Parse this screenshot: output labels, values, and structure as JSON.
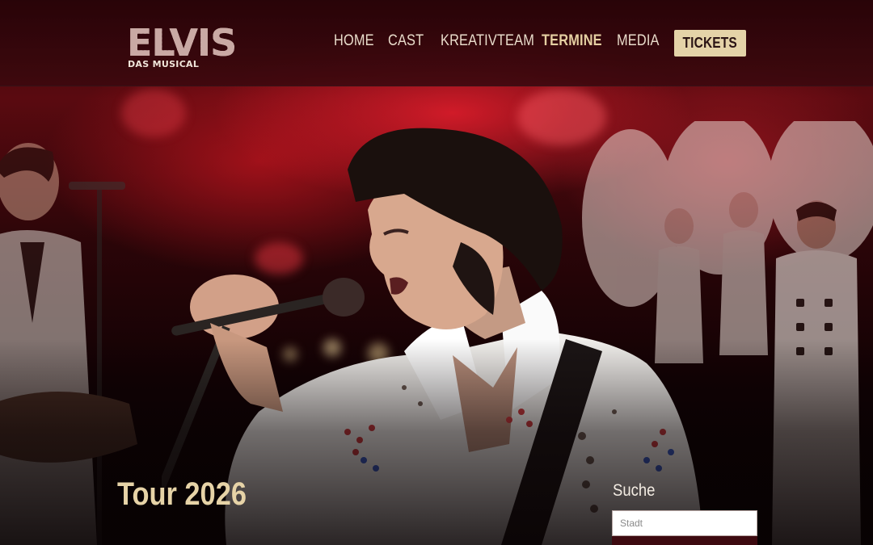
{
  "logo": {
    "word": "ELVIS",
    "subtitle": "DAS MUSICAL"
  },
  "nav": {
    "items": [
      {
        "label": "HOME",
        "active": false
      },
      {
        "label": "CAST",
        "active": false
      },
      {
        "label": "KREATIVTEAM",
        "active": false
      },
      {
        "label": "TERMINE",
        "active": true
      },
      {
        "label": "MEDIA",
        "active": false
      }
    ],
    "tickets_label": "TICKETS"
  },
  "hero": {
    "image": "elvis-singer-performance-photo"
  },
  "tour": {
    "title": "Tour 2026"
  },
  "search": {
    "label": "Suche",
    "placeholder": "Stadt",
    "value": ""
  },
  "colors": {
    "accent": "#e4d3a8",
    "header_bg": "#3a060c",
    "primary_red": "#b5121b"
  }
}
